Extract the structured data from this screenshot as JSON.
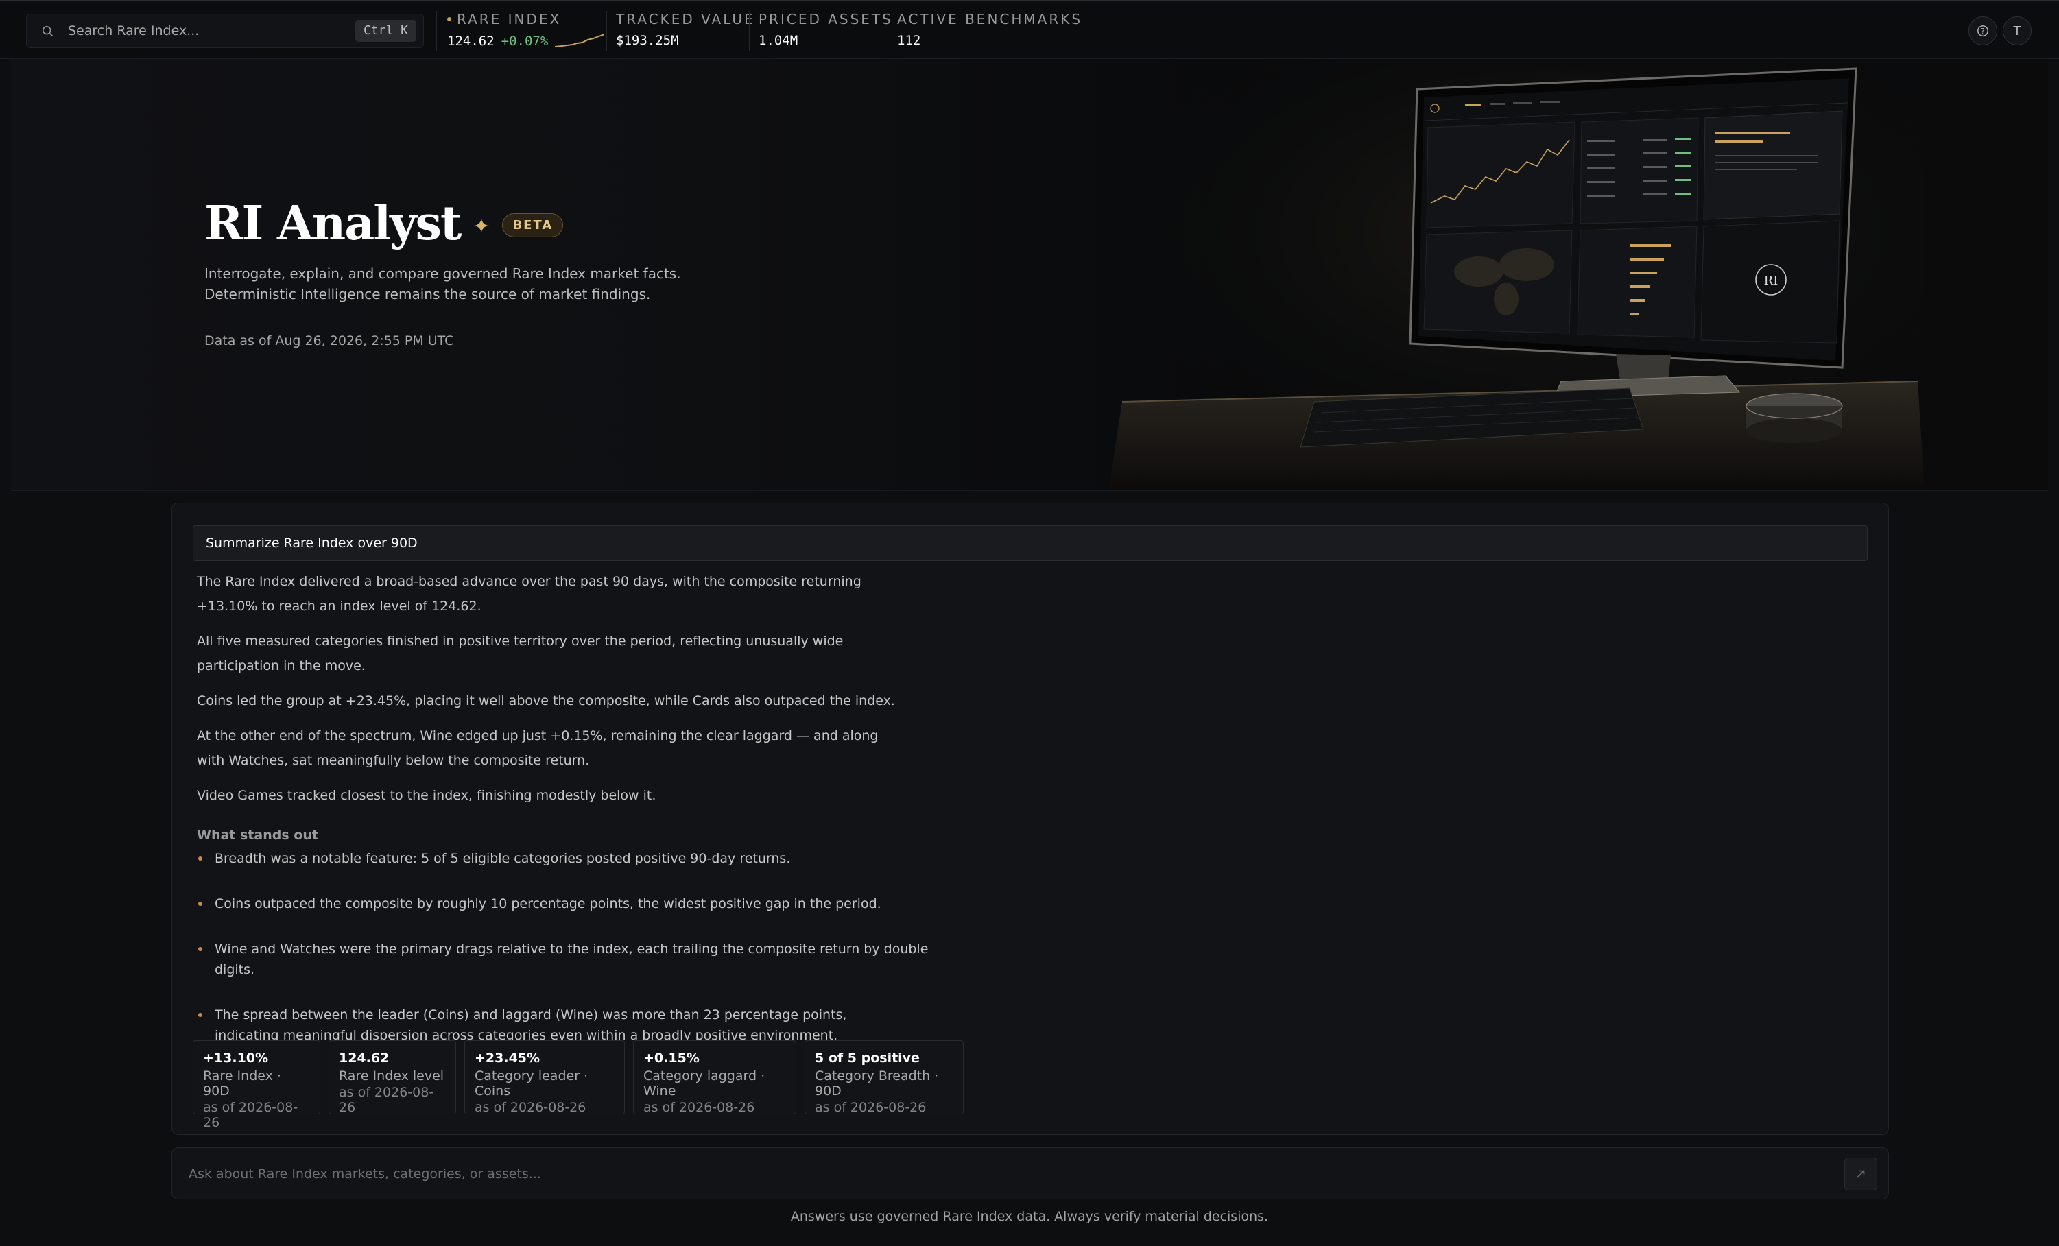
{
  "search": {
    "placeholder": "Search Rare Index...",
    "shortcut": "Ctrl K"
  },
  "ticker": [
    {
      "label": "RARE INDEX",
      "value": "124.62",
      "change": "+0.07%"
    },
    {
      "label": "TRACKED VALUE",
      "value": "$193.25M"
    },
    {
      "label": "PRICED ASSETS",
      "value": "1.04M"
    },
    {
      "label": "ACTIVE BENCHMARKS",
      "value": "112"
    }
  ],
  "topbar": {
    "help_icon": "help-circle-icon",
    "avatar_initial": "T"
  },
  "hero": {
    "title": "RI Analyst",
    "badge": "BETA",
    "subtitle_line1": "Interrogate, explain, and compare governed Rare Index market facts.",
    "subtitle_line2": "Deterministic Intelligence remains the source of market findings.",
    "as_of": "Data as of Aug 26, 2026, 2:55 PM UTC"
  },
  "answer": {
    "query": "Summarize Rare Index over 90D",
    "paragraphs": [
      "The Rare Index delivered a broad-based advance over the past 90 days, with the composite returning +13.10% to reach an index level of 124.62.",
      "All five measured categories finished in positive territory over the period, reflecting unusually wide participation in the move.",
      "Coins led the group at +23.45%, placing it well above the composite, while Cards also outpaced the index.",
      "At the other end of the spectrum, Wine edged up just +0.15%, remaining the clear laggard — and along with Watches, sat meaningfully below the composite return.",
      "Video Games tracked closest to the index, finishing modestly below it."
    ],
    "stands_out_heading": "What stands out",
    "bullets": [
      "Breadth was a notable feature: 5 of 5 eligible categories posted positive 90-day returns.",
      "Coins outpaced the composite by roughly 10 percentage points, the widest positive gap in the period.",
      "Wine and Watches were the primary drags relative to the index, each trailing the composite return by double digits.",
      "The spread between the leader (Coins) and laggard (Wine) was more than 23 percentage points, indicating meaningful dispersion across categories even within a broadly positive environment."
    ],
    "metrics": [
      {
        "value": "+13.10%",
        "label": "Rare Index · 90D",
        "as_of": "as of 2026-08-26"
      },
      {
        "value": "124.62",
        "label": "Rare Index level",
        "as_of": "as of 2026-08-26"
      },
      {
        "value": "+23.45%",
        "label": "Category leader · Coins",
        "as_of": "as of 2026-08-26"
      },
      {
        "value": "+0.15%",
        "label": "Category laggard · Wine",
        "as_of": "as of 2026-08-26"
      },
      {
        "value": "5 of 5 positive",
        "label": "Category Breadth · 90D",
        "as_of": "as of 2026-08-26"
      }
    ]
  },
  "ask": {
    "placeholder": "Ask about Rare Index markets, categories, or assets..."
  },
  "disclaimer": "Answers use governed Rare Index data. Always verify material decisions.",
  "colors": {
    "accent_gold": "#c9a25b",
    "positive": "#6fbf7f",
    "bullet": "#c98c4a"
  }
}
